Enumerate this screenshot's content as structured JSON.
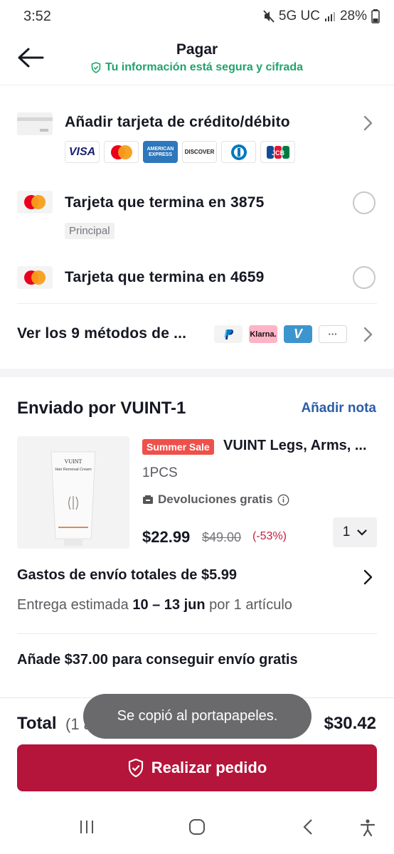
{
  "status_bar": {
    "time": "3:52",
    "network": "5G UC",
    "battery": "28%"
  },
  "header": {
    "title": "Pagar",
    "subtitle": "Tu información está segura y cifrada"
  },
  "payment": {
    "add_card_label": "Añadir tarjeta de crédito/débito",
    "brands": [
      "VISA",
      "mastercard",
      "AMERICAN EXPRESS",
      "DISCOVER",
      "Diners Club",
      "JCB"
    ],
    "cards": [
      {
        "label": "Tarjeta que termina en 3875",
        "badge": "Principal",
        "selected": false
      },
      {
        "label": "Tarjeta que termina en 4659",
        "selected": false
      }
    ],
    "more_methods_label": "Ver los 9 métodos de ...",
    "more_icons": [
      "PayPal",
      "Klarna.",
      "Venmo",
      "···"
    ]
  },
  "order": {
    "seller_title": "Enviado por VUINT-1",
    "add_note": "Añadir nota",
    "product": {
      "badge": "Summer Sale",
      "name": "VUINT Legs, Arms, ...",
      "variant": "1PCS",
      "returns": "Devoluciones gratis",
      "price": "$22.99",
      "old_price": "$49.00",
      "discount": "(-53%)",
      "quantity": "1",
      "image_brand": "VUINT",
      "image_product": "Hair Removal Cream"
    },
    "shipping_total": "Gastos de envío totales de $5.99",
    "eta_prefix": "Entrega estimada",
    "eta_dates": "10 – 13 jun",
    "eta_suffix": "por 1 artículo",
    "free_shipping": "Añade $37.00 para conseguir envío gratis"
  },
  "footer": {
    "total_label": "Total",
    "total_count": "(1 artículo)",
    "total_amount": "$30.42",
    "toast": "Se copió al portapapeles.",
    "place_order": "Realizar pedido"
  },
  "colors": {
    "accent": "#b5143b",
    "secure_green": "#20a36b",
    "link_blue": "#2b5da8",
    "sale_red": "#f0504a"
  }
}
